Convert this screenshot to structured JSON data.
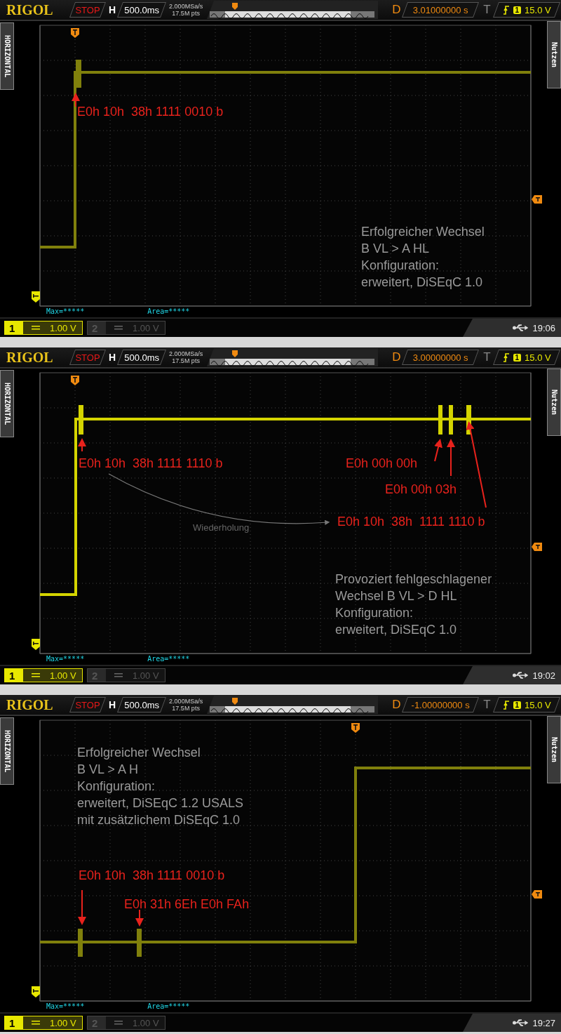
{
  "panels": [
    {
      "logo": "RIGOL",
      "run_state": "STOP",
      "h_label": "H",
      "timebase": "500.0ms",
      "sample_rate": "2.000MSa/s",
      "memory_depth": "17.5M pts",
      "delay_label": "D",
      "delay": "3.01000000 s",
      "trigger_label": "T",
      "trigger_source": "1",
      "trigger_level": "15.0 V",
      "side_left": "HORIZONTAL",
      "side_right": "Nutzen",
      "measurements": [
        "Max=*****",
        "Area=*****"
      ],
      "channels": [
        {
          "number": "1",
          "scale": "1.00 V",
          "on": true
        },
        {
          "number": "2",
          "scale": "1.00 V",
          "on": false
        }
      ],
      "clock": "19:06",
      "annotations": [
        {
          "kind": "label",
          "text": "E0h 10h  38h 1111 0010 b"
        }
      ],
      "note": "Erfolgreicher Wechsel\nB VL > A HL\nKonfiguration:\nerweitert, DiSEqC 1.0"
    },
    {
      "logo": "RIGOL",
      "run_state": "STOP",
      "h_label": "H",
      "timebase": "500.0ms",
      "sample_rate": "2.000MSa/s",
      "memory_depth": "17.5M pts",
      "delay_label": "D",
      "delay": "3.00000000 s",
      "trigger_label": "T",
      "trigger_source": "1",
      "trigger_level": "15.0 V",
      "side_left": "HORIZONTAL",
      "side_right": "Nutzen",
      "measurements": [
        "Max=*****",
        "Area=*****"
      ],
      "channels": [
        {
          "number": "1",
          "scale": "1.00 V",
          "on": true
        },
        {
          "number": "2",
          "scale": "1.00 V",
          "on": false
        }
      ],
      "clock": "19:02",
      "annotations": [
        {
          "kind": "label",
          "text": "E0h 10h  38h 1111 1110 b"
        },
        {
          "kind": "label",
          "text": "E0h 00h 00h"
        },
        {
          "kind": "label",
          "text": "E0h 00h 03h"
        },
        {
          "kind": "label",
          "text": "E0h 10h  38h  1111 1110 b"
        },
        {
          "kind": "caption",
          "text": "Wiederholung"
        }
      ],
      "note": "Provoziert fehlgeschlagener\nWechsel B VL > D HL\nKonfiguration:\nerweitert, DiSEqC 1.0"
    },
    {
      "logo": "RIGOL",
      "run_state": "STOP",
      "h_label": "H",
      "timebase": "500.0ms",
      "sample_rate": "2.000MSa/s",
      "memory_depth": "17.5M pts",
      "delay_label": "D",
      "delay": "-1.00000000 s",
      "trigger_label": "T",
      "trigger_source": "1",
      "trigger_level": "15.0 V",
      "side_left": "HORIZONTAL",
      "side_right": "Nutzen",
      "measurements": [
        "Max=*****",
        "Area=*****"
      ],
      "channels": [
        {
          "number": "1",
          "scale": "1.00 V",
          "on": true
        },
        {
          "number": "2",
          "scale": "1.00 V",
          "on": false
        }
      ],
      "clock": "19:27",
      "annotations": [
        {
          "kind": "label",
          "text": "E0h 10h  38h 1111 0010 b"
        },
        {
          "kind": "label",
          "text": "E0h 31h 6Eh E0h FAh"
        }
      ],
      "note": "Erfolgreicher Wechsel\nB VL > A H\nKonfiguration:\nerweitert, DiSEqC 1.2 USALS\nmit zusätzlichem DiSEqC 1.0"
    }
  ]
}
